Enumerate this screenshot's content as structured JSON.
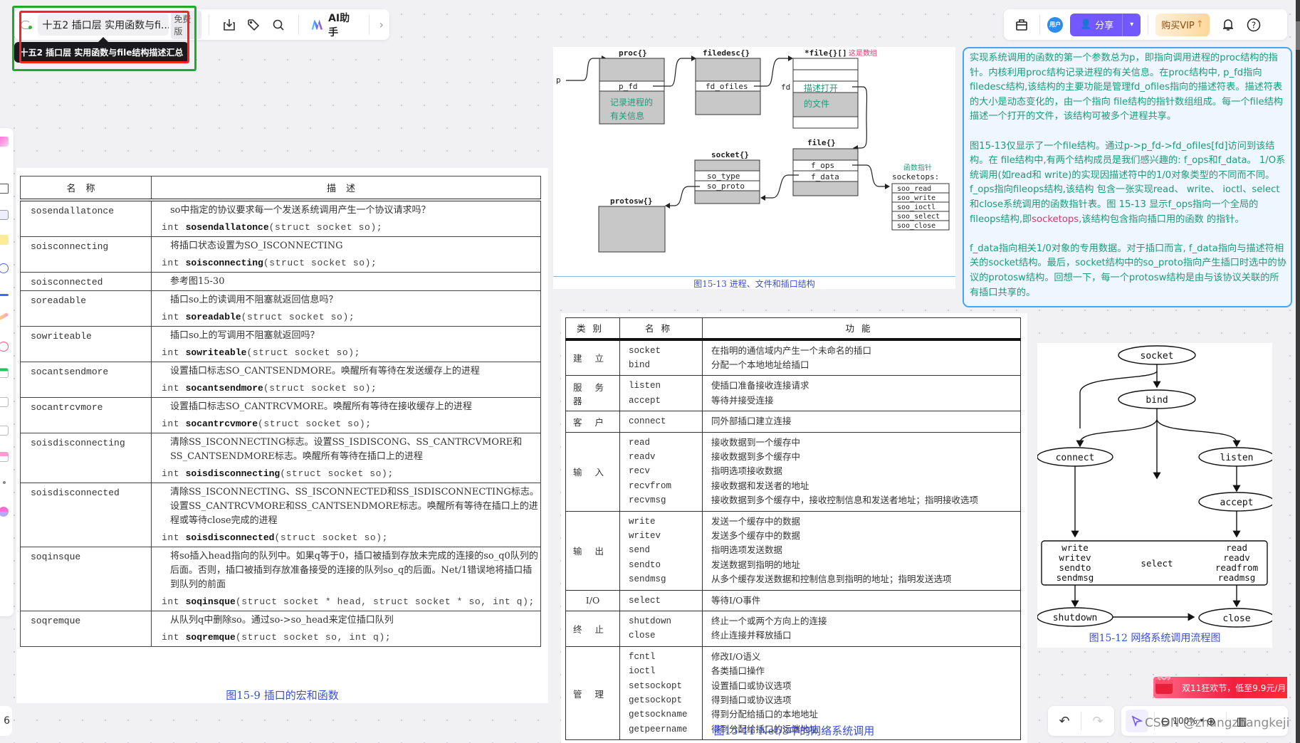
{
  "toolbar": {
    "doc_title_short": "十五2 插口层 实用函数与fi...",
    "badge": "免费版",
    "tooltip": "十五2 插口层 实用函数与file结构描述汇总",
    "ai_label": "AI助手",
    "icons": [
      "sync-status-icon",
      "download-icon",
      "tag-icon",
      "search-icon",
      "ai-logo-icon",
      "chevron-right-icon"
    ]
  },
  "header_right": {
    "avatar_label": "用户",
    "share_label": "分享",
    "vip_label": "购买VIP",
    "icons": [
      "toolbox-icon",
      "share-user-icon",
      "chevron-down-icon",
      "bell-icon",
      "help-icon"
    ]
  },
  "table_15_9": {
    "headers": [
      "名称",
      "描述"
    ],
    "rows": [
      {
        "name": "sosendallatonce",
        "desc": "so中指定的协议要求每一个发送系统调用产生一个协议请求吗？",
        "proto_pre": "int ",
        "proto_fn": "sosendallatonce",
        "proto_args": "(struct socket so);"
      },
      {
        "name": "soisconnecting",
        "desc": "将插口状态设置为SO_ISCONNECTING",
        "proto_pre": "int ",
        "proto_fn": "soisconnecting",
        "proto_args": "(struct socket so);"
      },
      {
        "name": "soisconnected",
        "desc": "参考图15-30",
        "proto_pre": "",
        "proto_fn": "",
        "proto_args": ""
      },
      {
        "name": "soreadable",
        "desc": "插口so上的读调用不阻塞就返回信息吗？",
        "proto_pre": "int ",
        "proto_fn": "soreadable",
        "proto_args": "(struct socket so);"
      },
      {
        "name": "sowriteable",
        "desc": "插口so上的写调用不阻塞就返回吗？",
        "proto_pre": "int ",
        "proto_fn": "sowriteable",
        "proto_args": "(struct socket so);"
      },
      {
        "name": "socantsendmore",
        "desc": "设置插口标志SO_CANTSENDMORE。唤醒所有等待在发送缓存上的进程",
        "proto_pre": "int ",
        "proto_fn": "socantsendmore",
        "proto_args": "(struct socket so);"
      },
      {
        "name": "socantrcvmore",
        "desc": "设置插口标志SO_CANTRCVMORE。唤醒所有等待在接收缓存上的进程",
        "proto_pre": "int ",
        "proto_fn": "socantrcvmore",
        "proto_args": "(struct socket so);"
      },
      {
        "name": "soisdisconnecting",
        "desc": "清除SS_ISCONNECTING标志。设置SS_ISDISCONG、SS_CANTRCVMORE和SS_CANTSENDMORE标志。唤醒所有等待在插口上的进程",
        "proto_pre": "int ",
        "proto_fn": "soisdisconnecting",
        "proto_args": "(struct socket so);"
      },
      {
        "name": "soisdisconnected",
        "desc": "清除SS_ISCONNECTING、SS_ISCONNECTED和SS_ISDISCONNECTING标志。设置SS_CANTRCVMORE和SS_CANTSENDMORE标志。唤醒所有等待在插口上的进程或等待close完成的进程",
        "proto_pre": "int ",
        "proto_fn": "soisdisconnected",
        "proto_args": "(struct socket so);"
      },
      {
        "name": "soqinsque",
        "desc": "将so插入head指向的队列中。如果q等于0，插口被插到存放未完成的连接的so_q0队列的后面。否则，插口被插到存放准备接受的连接的队列so_q的后面。Net/1错误地将插口插到队列的前面",
        "proto_pre": "int ",
        "proto_fn": "soqinsque",
        "proto_args": "(struct socket * head, struct socket * so, int q);"
      },
      {
        "name": "soqremque",
        "desc": "从队列q中删除so。通过so->so_head来定位插口队列",
        "proto_pre": "int ",
        "proto_fn": "soqremque",
        "proto_args": "(struct socket so, int q);"
      }
    ],
    "caption": "图15-9   插口的宏和函数"
  },
  "fig_15_13": {
    "labels": {
      "p": "p",
      "proc": "proc{}",
      "p_fd": "p_fd",
      "proc_note": "记录进程的\n有关信息",
      "filedesc": "filedesc{}",
      "fd_ofiles": "fd_ofiles",
      "fd": "fd",
      "file_array": "*file{}[]",
      "array_note": "这是数组",
      "file_note": "描述打开\n的文件",
      "file": "file{}",
      "f_ops": "f_ops",
      "f_data": "f_data",
      "fnptr_note": "函数指针",
      "socketops": "socketops:",
      "ops": [
        "soo_read",
        "soo_write",
        "soo_ioctl",
        "soo_select",
        "soo_close"
      ],
      "socket": "socket{}",
      "so_type": "so_type",
      "so_proto": "so_proto",
      "protosw": "protosw{}"
    },
    "caption": "图15-13   进程、文件和插口结构"
  },
  "note": {
    "paragraphs": [
      {
        "text": "实现系统调用的函数的第一个参数总为p，即指向调用进程的proc结构的指针。内核利用proc结构记录进程的有关信息。在proc结构中, p_fd指向filedesc结构,该结构的主要功能是管理fd_ofiles指向的描述符表。描述符表的大小是动态变化的，由一个指向 file结构的指针数组组成。每一个file结构描述一个打开的文件，该结构可被多个进程共享。"
      },
      {
        "text_before": "图15-13仅显示了一个file结构。通过p->p_fd->fd_ofiles[fd]访问到该结构。在 file结构中,有两个结构成员是我们感兴趣的: f_ops和f_data。 1/O系统调用(如read和 write)的实现因描述符中的1/0对象类型的不同而不同。f_ops指向fileops结构,该结构 包含一张实现read、 write、 ioctl、select和close系统调用的函数指针表。图 15-13 显示f_ops指向一个全局的fileops结构,即",
        "highlight": "socketops",
        "text_after": ",该结构包含指向插口用的函数 的指针。"
      },
      {
        "text": "f_data指向相关1/0对象的专用数据。对于插口而言, f_data指向与描述符相关的socket结构。最后，socket结构中的so_proto指向产生插口时选中的协议的protosw结构。回想一下，每一个protosw结构是由与该协议关联的所有插口共享的。"
      }
    ],
    "colors": {
      "text": "#1e9a77",
      "highlight": "#ef2f6a",
      "border": "#4aa3f0"
    }
  },
  "table_15_11": {
    "headers": [
      "类别",
      "名称",
      "功能"
    ],
    "groups": [
      {
        "category": "建立",
        "items": [
          [
            "socket",
            "在指明的通信域内产生一个未命名的插口"
          ],
          [
            "bind",
            "分配一个本地地址给插口"
          ]
        ]
      },
      {
        "category": "服务器",
        "items": [
          [
            "listen",
            "使插口准备接收连接请求"
          ],
          [
            "accept",
            "等待并接受连接"
          ]
        ]
      },
      {
        "category": "客户",
        "items": [
          [
            "connect",
            "同外部插口建立连接"
          ]
        ]
      },
      {
        "category": "输入",
        "items": [
          [
            "read",
            "接收数据到一个缓存中"
          ],
          [
            "readv",
            "接收数据到多个缓存中"
          ],
          [
            "recv",
            "指明选项接收数据"
          ],
          [
            "recvfrom",
            "接收数据和发送者的地址"
          ],
          [
            "recvmsg",
            "接收数据到多个缓存中，接收控制信息和发送者地址；指明接收选项"
          ]
        ]
      },
      {
        "category": "输出",
        "items": [
          [
            "write",
            "发送一个缓存中的数据"
          ],
          [
            "writev",
            "发送多个缓存中的数据"
          ],
          [
            "send",
            "指明选项发送数据"
          ],
          [
            "sendto",
            "发送数据到指明的地址"
          ],
          [
            "sendmsg",
            "从多个缓存发送数据和控制信息到指明的地址；指明发送选项"
          ]
        ]
      },
      {
        "category": "I/O",
        "items": [
          [
            "select",
            "等待I/O事件"
          ]
        ]
      },
      {
        "category": "终止",
        "items": [
          [
            "shutdown",
            "终止一个或两个方向上的连接"
          ],
          [
            "close",
            "终止连接并释放插口"
          ]
        ]
      },
      {
        "category": "管理",
        "items": [
          [
            "fcntl",
            "修改I/O语义"
          ],
          [
            "ioctl",
            "各类插口操作"
          ],
          [
            "setsockopt",
            "设置插口或协议选项"
          ],
          [
            "getsockopt",
            "得到插口或协议选项"
          ],
          [
            "getsockname",
            "得到分配给插口的本地地址"
          ],
          [
            "getpeername",
            "得到分配给插口的远端地址"
          ]
        ]
      }
    ],
    "caption": "图15-11   Net/3中的网络系统调用"
  },
  "fig_15_12": {
    "nodes": {
      "socket": "socket",
      "bind": "bind",
      "connect": "connect",
      "listen": "listen",
      "accept": "accept",
      "io_left": [
        "write",
        "writev",
        "sendto",
        "sendmsg"
      ],
      "io_mid": "select",
      "io_right": [
        "read",
        "readv",
        "readfrom",
        "readmsg"
      ],
      "shutdown": "shutdown",
      "close": "close"
    },
    "caption": "图15-12   网络系统调用流程图"
  },
  "promo": {
    "text": "双11狂欢节，低至9.9元/月"
  },
  "bottom_toolbar": {
    "zoom_level": "100%",
    "icons": [
      "undo-icon",
      "redo-icon",
      "select-pointer-icon",
      "zoom-out-icon",
      "zoom-in-icon",
      "map-icon"
    ]
  },
  "watermark": "CSDN @zhangzhangkeji"
}
